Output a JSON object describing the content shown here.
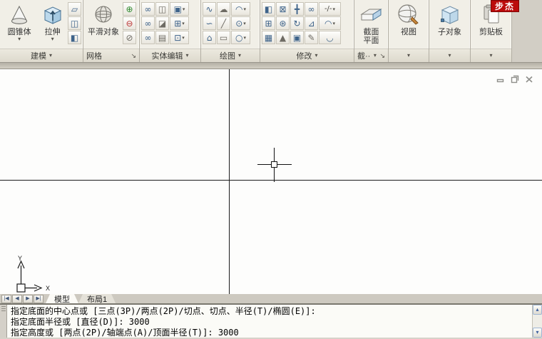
{
  "watermark": {
    "text": "步杰"
  },
  "glyphs": {
    "dropdown": "▾",
    "launcher": "↘",
    "scroll_up": "▴",
    "scroll_down": "▾",
    "nav_first": "|◀",
    "nav_prev": "◀",
    "nav_next": "▶",
    "nav_last": "▶|"
  },
  "ribbon": {
    "modeling": {
      "label": "建模",
      "cone_label": "圆锥体",
      "extrude_label": "拉伸",
      "icons": {
        "polysolid": "▱",
        "planar_surface": "◫",
        "presspull": "◧"
      }
    },
    "mesh": {
      "label": "网格",
      "smooth_label": "平滑对象",
      "icons": {
        "mesh_refine": "⊕",
        "mesh_reduce": "⊖",
        "unsmooth": "⊘"
      }
    },
    "solid_editing": {
      "label": "实体编辑",
      "icons": {
        "union": "∞",
        "slice": "◫",
        "extrude_faces": "▣",
        "subtract": "∞",
        "thicken": "◪",
        "move_faces": "⊞",
        "intersect": "∞",
        "clean": "▤",
        "separate": "⊡"
      }
    },
    "draw": {
      "label": "绘图",
      "icons": {
        "polyline": "∿",
        "revision_cloud": "☁",
        "arc": "◠",
        "spline": "∽",
        "line": "╱",
        "circle": "⊙",
        "polygon": "⌂",
        "rectangle": "▭",
        "ellipse": "○"
      }
    },
    "modify": {
      "label": "修改",
      "icons": {
        "mirror3d": "◧",
        "rotate3d": "⊠",
        "move3d": "╋",
        "align3d": "∞",
        "break": "-/-",
        "array3d": "⊞",
        "scale_gizmo": "⊛",
        "rotate": "↻",
        "align": "⊿",
        "fillet": "◠",
        "array": "▦",
        "scale": "▲",
        "offset": "▣",
        "trim": "✎",
        "fillet_edge": "◡"
      }
    },
    "section": {
      "label": "截··",
      "button_label": "截面平面"
    },
    "view": {
      "label": "视图"
    },
    "subobject": {
      "label": "子对象"
    },
    "clipboard": {
      "label": "剪贴板"
    }
  },
  "canvas": {
    "ucs": {
      "x": "X",
      "y": "Y"
    }
  },
  "tabs": {
    "model": "模型",
    "layout1": "布局1"
  },
  "command": {
    "lines": [
      "指定底面的中心点或 [三点(3P)/两点(2P)/切点、切点、半径(T)/椭圆(E)]:",
      "指定底面半径或 [直径(D)]: 3000",
      "指定高度或 [两点(2P)/轴端点(A)/顶面半径(T)]: 3000"
    ]
  }
}
